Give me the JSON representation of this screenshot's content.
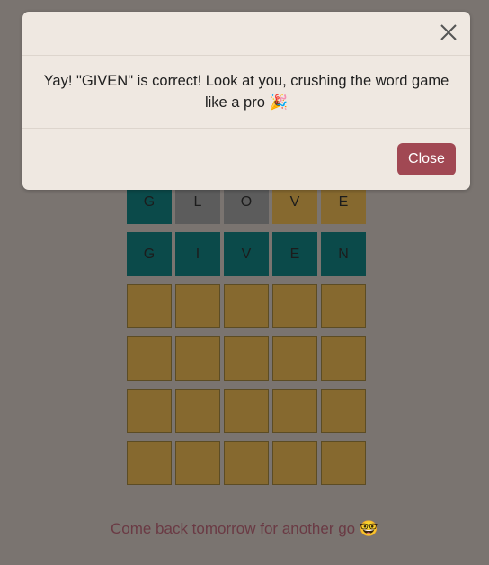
{
  "board": {
    "rows": [
      [
        {
          "letter": "G",
          "state": "correct"
        },
        {
          "letter": "L",
          "state": "absent"
        },
        {
          "letter": "O",
          "state": "absent"
        },
        {
          "letter": "V",
          "state": "present"
        },
        {
          "letter": "E",
          "state": "present"
        }
      ],
      [
        {
          "letter": "G",
          "state": "correct"
        },
        {
          "letter": "I",
          "state": "correct"
        },
        {
          "letter": "V",
          "state": "correct"
        },
        {
          "letter": "E",
          "state": "correct"
        },
        {
          "letter": "N",
          "state": "correct"
        }
      ],
      [
        {
          "letter": "",
          "state": "empty"
        },
        {
          "letter": "",
          "state": "empty"
        },
        {
          "letter": "",
          "state": "empty"
        },
        {
          "letter": "",
          "state": "empty"
        },
        {
          "letter": "",
          "state": "empty"
        }
      ],
      [
        {
          "letter": "",
          "state": "empty"
        },
        {
          "letter": "",
          "state": "empty"
        },
        {
          "letter": "",
          "state": "empty"
        },
        {
          "letter": "",
          "state": "empty"
        },
        {
          "letter": "",
          "state": "empty"
        }
      ],
      [
        {
          "letter": "",
          "state": "empty"
        },
        {
          "letter": "",
          "state": "empty"
        },
        {
          "letter": "",
          "state": "empty"
        },
        {
          "letter": "",
          "state": "empty"
        },
        {
          "letter": "",
          "state": "empty"
        }
      ],
      [
        {
          "letter": "",
          "state": "empty"
        },
        {
          "letter": "",
          "state": "empty"
        },
        {
          "letter": "",
          "state": "empty"
        },
        {
          "letter": "",
          "state": "empty"
        },
        {
          "letter": "",
          "state": "empty"
        }
      ]
    ]
  },
  "footer": {
    "message": "Come back tomorrow for another go 🤓"
  },
  "modal": {
    "message": "Yay! \"GIVEN\" is correct! Look at you, crushing the word game like a pro 🎉",
    "close_icon": "close-icon",
    "close_button_label": "Close"
  },
  "colors": {
    "correct": "#0b4a4a",
    "absent": "#5c5c5c",
    "present": "#86692f",
    "button": "#a14853"
  }
}
